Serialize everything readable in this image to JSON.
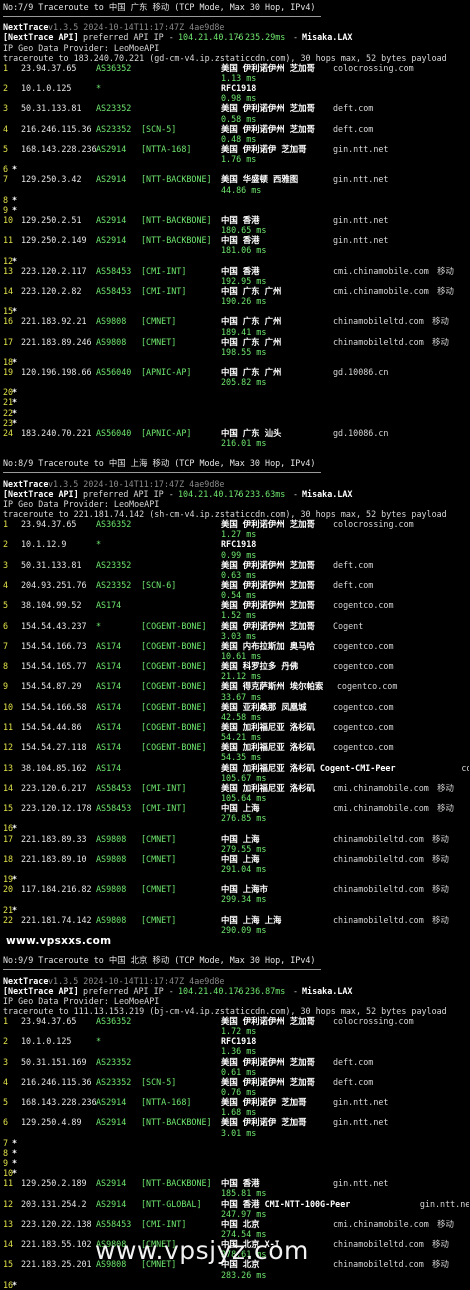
{
  "app": {
    "name": "NextTrace",
    "version": "v1.3.5 2024-10-14T11:17:47Z 4ae9d8e"
  },
  "sections": [
    {
      "title": "No:7/9 Traceroute to 中国 广东 移动 (TCP Mode, Max 30 Hop, IPv4)",
      "api_label": "[NextTrace API]",
      "api_text": " preferred API IP - ",
      "api_ip": "104.21.40.176",
      "api_ms": "235.29ms",
      "api_node": "Misaka.LAX",
      "geo": "IP Geo Data Provider: LeoMoeAPI",
      "trace": "traceroute to 183.240.70.221 (gd-cm-v4.ip.zstaticcdn.com), 30 hops max, 52 bytes payload",
      "hops": [
        {
          "n": "1",
          "ip": "23.94.37.65",
          "asn": "AS36352",
          "tag": "",
          "geo": "美国 伊利诺伊州 芝加哥",
          "host": "colocrossing.com",
          "isp": "",
          "rtt": "1.13 ms"
        },
        {
          "n": "2",
          "ip": "10.1.0.125",
          "asn": "*",
          "tag": "",
          "geo": "RFC1918",
          "host": "",
          "isp": "",
          "rtt": "0.98 ms"
        },
        {
          "n": "3",
          "ip": "50.31.133.81",
          "asn": "AS23352",
          "tag": "",
          "geo": "美国 伊利诺伊州 芝加哥",
          "host": "deft.com",
          "isp": "",
          "rtt": "0.58 ms"
        },
        {
          "n": "4",
          "ip": "216.246.115.36",
          "asn": "AS23352",
          "tag": "[SCN-5]",
          "geo": "美国 伊利诺伊州 芝加哥",
          "host": "deft.com",
          "isp": "",
          "rtt": "0.48 ms"
        },
        {
          "n": "5",
          "ip": "168.143.228.236",
          "asn": "AS2914",
          "tag": "[NTTA-168]",
          "geo": "美国 伊利诺伊 芝加哥",
          "host": "gin.ntt.net",
          "isp": "",
          "rtt": "1.76 ms"
        },
        {
          "n": "6",
          "star": true
        },
        {
          "n": "7",
          "ip": "129.250.3.42",
          "asn": "AS2914",
          "tag": "[NTT-BACKBONE]",
          "geo": "美国 华盛顿 西雅图",
          "host": "gin.ntt.net",
          "isp": "",
          "rtt": "44.86 ms"
        },
        {
          "n": "8",
          "star": true
        },
        {
          "n": "9",
          "star": true
        },
        {
          "n": "10",
          "ip": "129.250.2.51",
          "asn": "AS2914",
          "tag": "[NTT-BACKBONE]",
          "geo": "中国 香港",
          "host": "gin.ntt.net",
          "isp": "",
          "rtt": "180.65 ms"
        },
        {
          "n": "11",
          "ip": "129.250.2.149",
          "asn": "AS2914",
          "tag": "[NTT-BACKBONE]",
          "geo": "中国 香港",
          "host": "gin.ntt.net",
          "isp": "",
          "rtt": "181.06 ms"
        },
        {
          "n": "12",
          "star": true
        },
        {
          "n": "13",
          "ip": "223.120.2.117",
          "asn": "AS58453",
          "tag": "[CMI-INT]",
          "geo": "中国 香港",
          "host": "cmi.chinamobile.com",
          "isp": "移动",
          "rtt": "192.95 ms"
        },
        {
          "n": "14",
          "ip": "223.120.2.82",
          "asn": "AS58453",
          "tag": "[CMI-INT]",
          "geo": "中国 广东 广州",
          "host": "cmi.chinamobile.com",
          "isp": "移动",
          "rtt": "190.26 ms"
        },
        {
          "n": "15",
          "star": true
        },
        {
          "n": "16",
          "ip": "221.183.92.21",
          "asn": "AS9808",
          "tag": "[CMNET]",
          "geo": "中国 广东 广州",
          "host": "chinamobileltd.com",
          "isp": "移动",
          "rtt": "189.41 ms"
        },
        {
          "n": "17",
          "ip": "221.183.89.246",
          "asn": "AS9808",
          "tag": "[CMNET]",
          "geo": "中国 广东 广州",
          "host": "chinamobileltd.com",
          "isp": "移动",
          "rtt": "198.55 ms"
        },
        {
          "n": "18",
          "star": true
        },
        {
          "n": "19",
          "ip": "120.196.198.66",
          "asn": "AS56040",
          "tag": "[APNIC-AP]",
          "geo": "中国 广东 广州",
          "host": "gd.10086.cn",
          "isp": "",
          "rtt": "205.82 ms"
        },
        {
          "n": "20",
          "star": true
        },
        {
          "n": "21",
          "star": true
        },
        {
          "n": "22",
          "star": true
        },
        {
          "n": "23",
          "star": true
        },
        {
          "n": "24",
          "ip": "183.240.70.221",
          "asn": "AS56040",
          "tag": "[APNIC-AP]",
          "geo": "中国 广东 汕头",
          "host": "gd.10086.cn",
          "isp": "",
          "rtt": "216.01 ms"
        }
      ]
    },
    {
      "title": "No:8/9 Traceroute to 中国 上海 移动 (TCP Mode, Max 30 Hop, IPv4)",
      "api_label": "[NextTrace API]",
      "api_text": " preferred API IP - ",
      "api_ip": "104.21.40.176",
      "api_ms": "233.63ms",
      "api_node": "Misaka.LAX",
      "geo": "IP Geo Data Provider: LeoMoeAPI",
      "trace": "traceroute to 221.181.74.142 (sh-cm-v4.ip.zstaticcdn.com), 30 hops max, 52 bytes payload",
      "hops": [
        {
          "n": "1",
          "ip": "23.94.37.65",
          "asn": "AS36352",
          "tag": "",
          "geo": "美国 伊利诺伊州 芝加哥",
          "host": "colocrossing.com",
          "isp": "",
          "rtt": "1.27 ms"
        },
        {
          "n": "2",
          "ip": "10.1.12.9",
          "asn": "*",
          "tag": "",
          "geo": "RFC1918",
          "host": "",
          "isp": "",
          "rtt": "0.99 ms"
        },
        {
          "n": "3",
          "ip": "50.31.133.81",
          "asn": "AS23352",
          "tag": "",
          "geo": "美国 伊利诺伊州 芝加哥",
          "host": "deft.com",
          "isp": "",
          "rtt": "0.63 ms"
        },
        {
          "n": "4",
          "ip": "204.93.251.76",
          "asn": "AS23352",
          "tag": "[SCN-6]",
          "geo": "美国 伊利诺伊州 芝加哥",
          "host": "deft.com",
          "isp": "",
          "rtt": "0.54 ms"
        },
        {
          "n": "5",
          "ip": "38.104.99.52",
          "asn": "AS174",
          "tag": "",
          "geo": "美国 伊利诺伊州 芝加哥",
          "host": "cogentco.com",
          "isp": "",
          "rtt": "1.52 ms"
        },
        {
          "n": "6",
          "ip": "154.54.43.237",
          "asn": "*",
          "tag": "[COGENT-BONE]",
          "geo": "美国 伊利诺伊州 芝加哥",
          "host": "Cogent",
          "isp": "",
          "rtt": "3.03 ms"
        },
        {
          "n": "7",
          "ip": "154.54.166.73",
          "asn": "AS174",
          "tag": "[COGENT-BONE]",
          "geo": "美国 内布拉斯加 奥马哈",
          "host": "cogentco.com",
          "isp": "",
          "rtt": "10.61 ms"
        },
        {
          "n": "8",
          "ip": "154.54.165.77",
          "asn": "AS174",
          "tag": "[COGENT-BONE]",
          "geo": "美国 科罗拉多 丹佛",
          "host": "cogentco.com",
          "isp": "",
          "rtt": "21.12 ms"
        },
        {
          "n": "9",
          "ip": "154.54.87.29",
          "asn": "AS174",
          "tag": "[COGENT-BONE]",
          "geo": "美国 得克萨斯州 埃尔帕索",
          "host": "cogentco.com",
          "isp": "",
          "rtt": "33.67 ms"
        },
        {
          "n": "10",
          "ip": "154.54.166.58",
          "asn": "AS174",
          "tag": "[COGENT-BONE]",
          "geo": "美国 亚利桑那 凤凰城",
          "host": "cogentco.com",
          "isp": "",
          "rtt": "42.58 ms"
        },
        {
          "n": "11",
          "ip": "154.54.44.86",
          "asn": "AS174",
          "tag": "[COGENT-BONE]",
          "geo": "美国 加利福尼亚 洛杉矶",
          "host": "cogentco.com",
          "isp": "",
          "rtt": "54.21 ms"
        },
        {
          "n": "12",
          "ip": "154.54.27.118",
          "asn": "AS174",
          "tag": "[COGENT-BONE]",
          "geo": "美国 加利福尼亚 洛杉矶",
          "host": "cogentco.com",
          "isp": "",
          "rtt": "54.35 ms"
        },
        {
          "n": "13",
          "ip": "38.104.85.162",
          "asn": "AS174",
          "tag": "",
          "geo": "美国 加利福尼亚 洛杉矶 Cogent-CMI-Peer",
          "host": "cogentco.com",
          "isp": "",
          "rtt": "105.67 ms"
        },
        {
          "n": "14",
          "ip": "223.120.6.217",
          "asn": "AS58453",
          "tag": "[CMI-INT]",
          "geo": "美国 加利福尼亚 洛杉矶",
          "host": "cmi.chinamobile.com",
          "isp": "移动",
          "rtt": "105.64 ms"
        },
        {
          "n": "15",
          "ip": "223.120.12.178",
          "asn": "AS58453",
          "tag": "[CMI-INT]",
          "geo": "中国 上海",
          "host": "cmi.chinamobile.com",
          "isp": "移动",
          "rtt": "276.85 ms"
        },
        {
          "n": "16",
          "star": true
        },
        {
          "n": "17",
          "ip": "221.183.89.33",
          "asn": "AS9808",
          "tag": "[CMNET]",
          "geo": "中国 上海",
          "host": "chinamobileltd.com",
          "isp": "移动",
          "rtt": "279.55 ms"
        },
        {
          "n": "18",
          "ip": "221.183.89.10",
          "asn": "AS9808",
          "tag": "[CMNET]",
          "geo": "中国 上海",
          "host": "chinamobileltd.com",
          "isp": "移动",
          "rtt": "291.04 ms"
        },
        {
          "n": "19",
          "star": true
        },
        {
          "n": "20",
          "ip": "117.184.216.82",
          "asn": "AS9808",
          "tag": "[CMNET]",
          "geo": "中国 上海市",
          "host": "chinamobileltd.com",
          "isp": "移动",
          "rtt": "299.34 ms"
        },
        {
          "n": "21",
          "star": true
        },
        {
          "n": "22",
          "ip": "221.181.74.142",
          "asn": "AS9808",
          "tag": "[CMNET]",
          "geo": "中国 上海 上海",
          "host": "chinamobileltd.com",
          "isp": "移动",
          "rtt": "290.09 ms"
        }
      ]
    },
    {
      "title": "No:9/9 Traceroute to 中国 北京 移动 (TCP Mode, Max 30 Hop, IPv4)",
      "api_label": "[NextTrace API]",
      "api_text": " preferred API IP - ",
      "api_ip": "104.21.40.176",
      "api_ms": "236.87ms",
      "api_node": "Misaka.LAX",
      "geo": "IP Geo Data Provider: LeoMoeAPI",
      "trace": "traceroute to 111.13.153.219 (bj-cm-v4.ip.zstaticcdn.com), 30 hops max, 52 bytes payload",
      "hops": [
        {
          "n": "1",
          "ip": "23.94.37.65",
          "asn": "AS36352",
          "tag": "",
          "geo": "美国 伊利诺伊州 芝加哥",
          "host": "colocrossing.com",
          "isp": "",
          "rtt": "1.72 ms"
        },
        {
          "n": "2",
          "ip": "10.1.0.125",
          "asn": "*",
          "tag": "",
          "geo": "RFC1918",
          "host": "",
          "isp": "",
          "rtt": "1.36 ms"
        },
        {
          "n": "3",
          "ip": "50.31.151.169",
          "asn": "AS23352",
          "tag": "",
          "geo": "美国 伊利诺伊州 芝加哥",
          "host": "deft.com",
          "isp": "",
          "rtt": "0.61 ms"
        },
        {
          "n": "4",
          "ip": "216.246.115.36",
          "asn": "AS23352",
          "tag": "[SCN-5]",
          "geo": "美国 伊利诺伊州 芝加哥",
          "host": "deft.com",
          "isp": "",
          "rtt": "0.76 ms"
        },
        {
          "n": "5",
          "ip": "168.143.228.236",
          "asn": "AS2914",
          "tag": "[NTTA-168]",
          "geo": "美国 伊利诺伊 芝加哥",
          "host": "gin.ntt.net",
          "isp": "",
          "rtt": "1.68 ms"
        },
        {
          "n": "6",
          "ip": "129.250.4.89",
          "asn": "AS2914",
          "tag": "[NTT-BACKBONE]",
          "geo": "美国 伊利诺伊 芝加哥",
          "host": "gin.ntt.net",
          "isp": "",
          "rtt": "3.01 ms"
        },
        {
          "n": "7",
          "star": true
        },
        {
          "n": "8",
          "star": true
        },
        {
          "n": "9",
          "star": true
        },
        {
          "n": "10",
          "star": true
        },
        {
          "n": "11",
          "ip": "129.250.2.189",
          "asn": "AS2914",
          "tag": "[NTT-BACKBONE]",
          "geo": "中国 香港",
          "host": "gin.ntt.net",
          "isp": "",
          "rtt": "185.81 ms"
        },
        {
          "n": "12",
          "ip": "203.131.254.2",
          "asn": "AS2914",
          "tag": "[NTT-GLOBAL]",
          "geo": "中国 香港 CMI-NTT-100G-Peer",
          "host": "gin.ntt.net",
          "isp": "",
          "rtt": "247.97 ms"
        },
        {
          "n": "13",
          "ip": "223.120.22.138",
          "asn": "AS58453",
          "tag": "[CMI-INT]",
          "geo": "中国 北京",
          "host": "cmi.chinamobile.com",
          "isp": "移动",
          "rtt": "274.54 ms"
        },
        {
          "n": "14",
          "ip": "221.183.55.102",
          "asn": "AS9808",
          "tag": "[CMNET]",
          "geo": "中国 北京 X-I",
          "host": "chinamobileltd.com",
          "isp": "移动",
          "rtt": "278.61 ms"
        },
        {
          "n": "15",
          "ip": "221.183.25.201",
          "asn": "AS9808",
          "tag": "[CMNET]",
          "geo": "中国 北京",
          "host": "chinamobileltd.com",
          "isp": "移动",
          "rtt": "283.26 ms"
        },
        {
          "n": "16",
          "star": true
        }
      ]
    }
  ],
  "watermarks": {
    "mid": "www.vpsxxs.com",
    "bottom": "www.vpsjyz.com"
  }
}
